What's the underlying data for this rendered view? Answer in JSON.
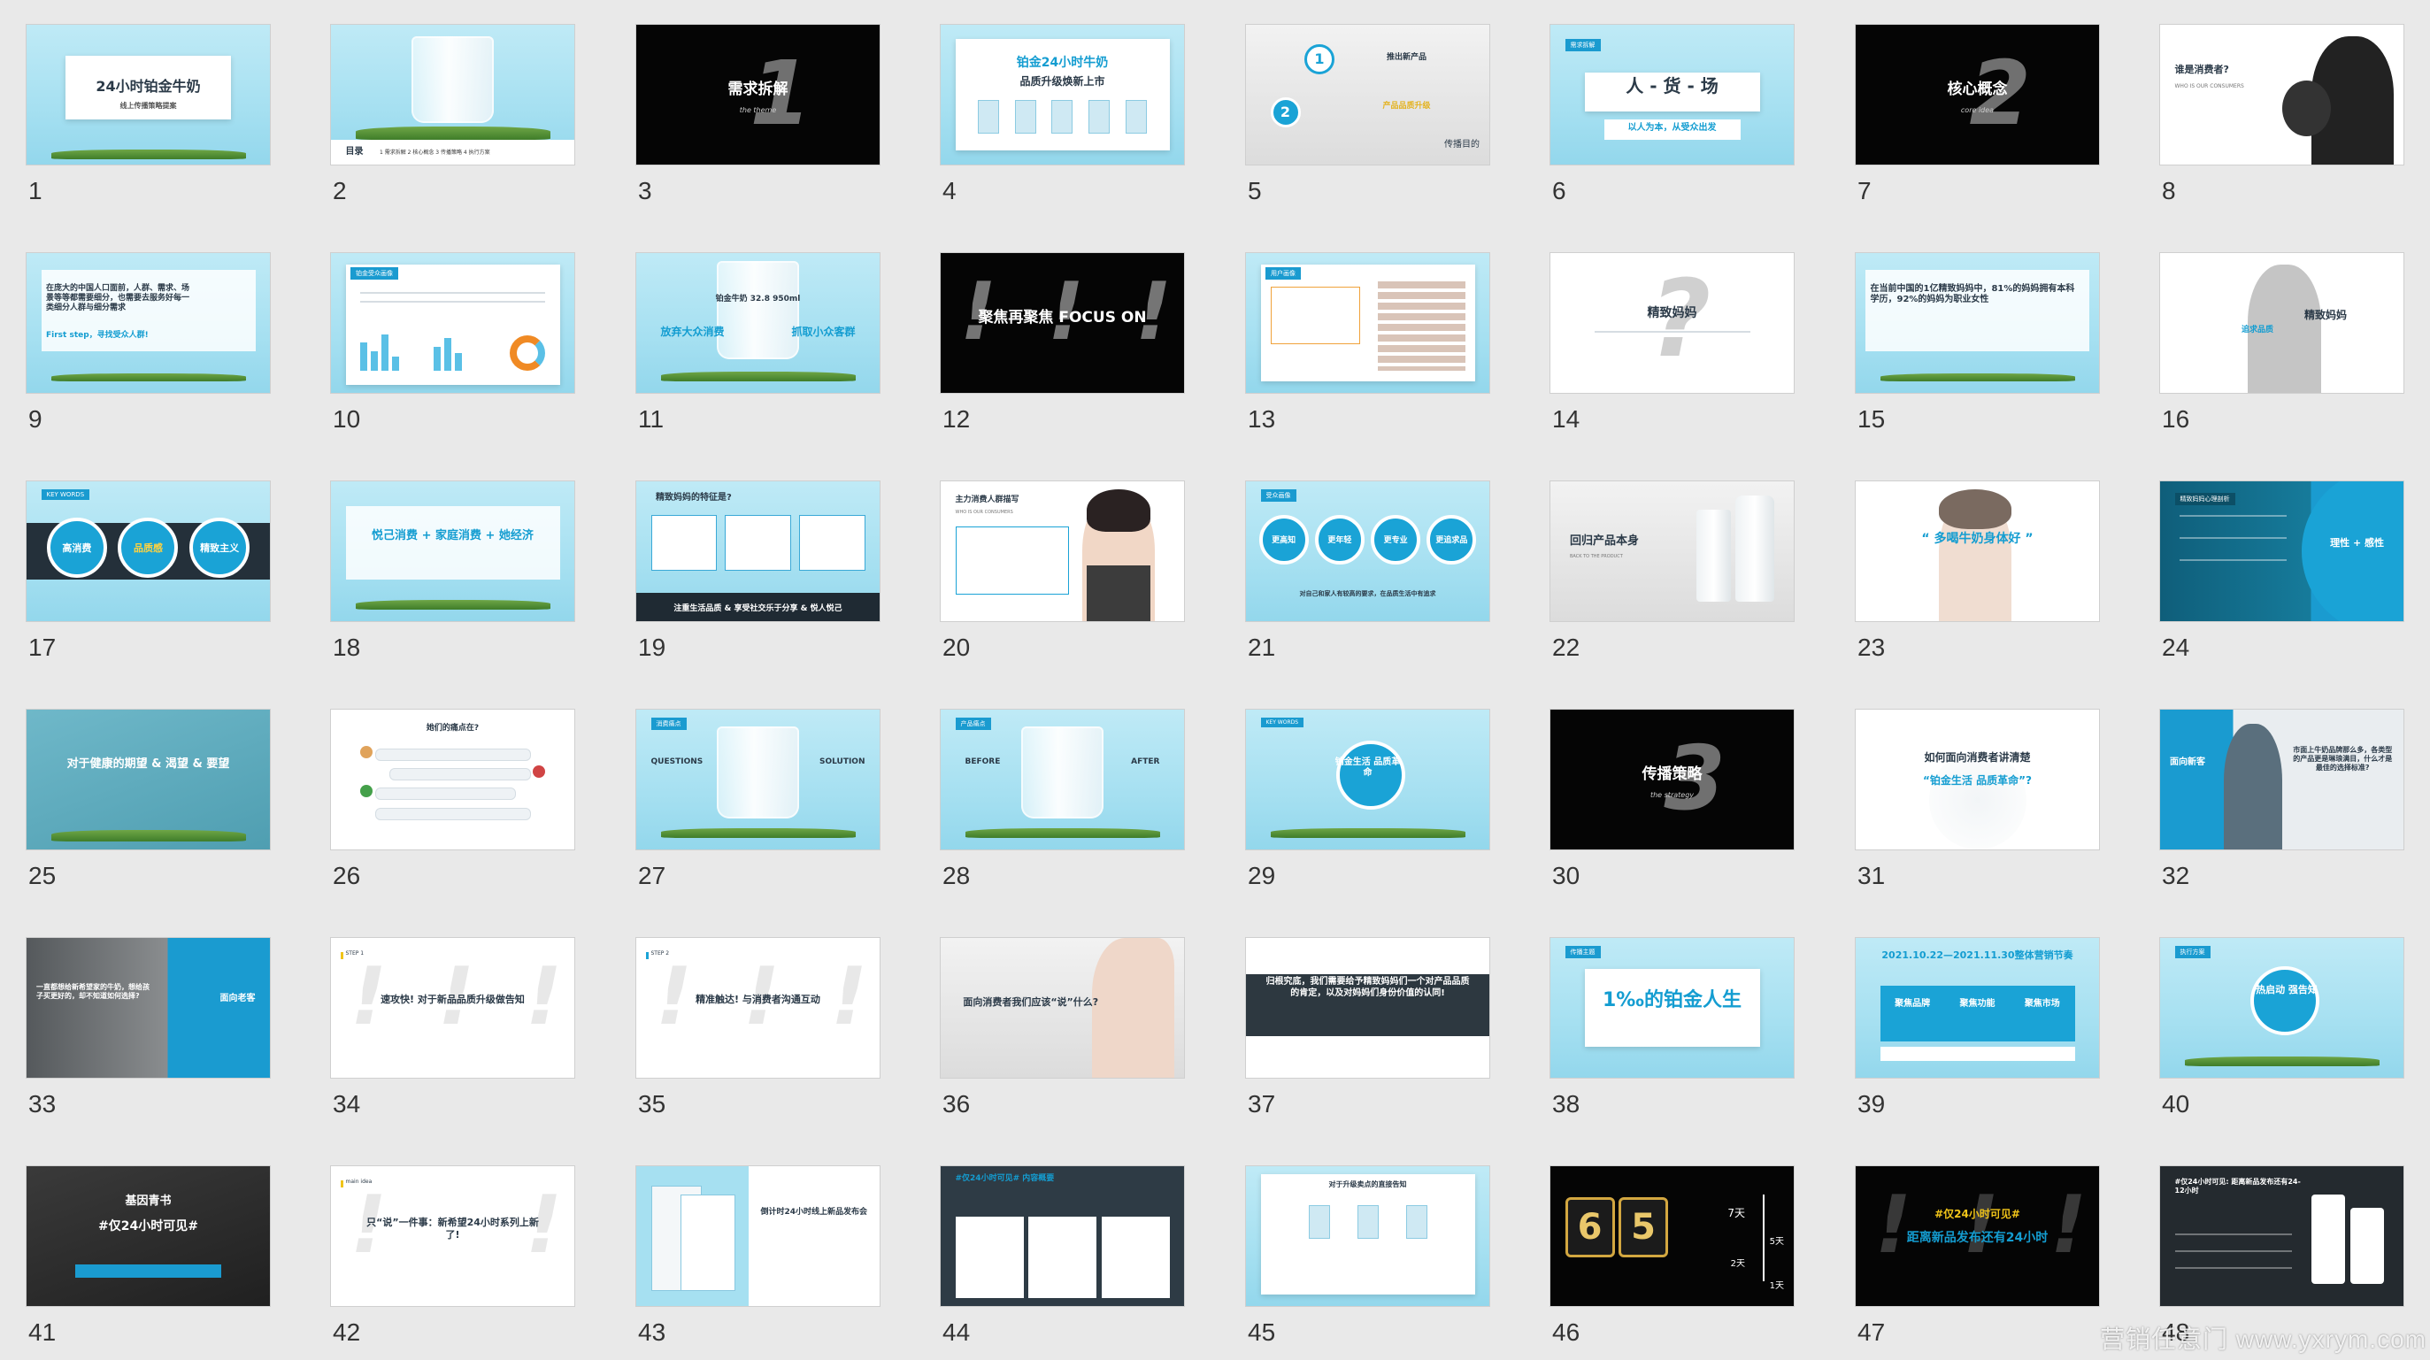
{
  "app": {
    "view": "slide-sorter"
  },
  "slides": [
    {
      "n": "1",
      "title": "24小时铂金牛奶",
      "subtitle": "线上传播策略提案"
    },
    {
      "n": "2",
      "title": "目录",
      "toc": "1 需求拆解 2 核心概念 3 传播策略 4 执行方案"
    },
    {
      "n": "3",
      "title": "需求拆解",
      "subtitle": "the theme",
      "big": "1"
    },
    {
      "n": "4",
      "title": "铂金24小时牛奶",
      "subtitle": "品质升级焕新上市"
    },
    {
      "n": "5",
      "title": "推出新产品",
      "sub2": "产品品质升级",
      "foot": "传播目的"
    },
    {
      "n": "6",
      "title": "人 - 货 - 场",
      "subtitle": "以人为本，从受众出发"
    },
    {
      "n": "7",
      "title": "核心概念",
      "subtitle": "core idea",
      "big": "2"
    },
    {
      "n": "8",
      "title": "谁是消费者?",
      "subtitle": "WHO IS OUR CONSUMERS"
    },
    {
      "n": "9",
      "title": "在庞大的中国人口面前，人群、需求、场景等等都需要细分，也需要去服务好每一类细分人群与细分需求",
      "subtitle": "First step，寻找受众人群!"
    },
    {
      "n": "10",
      "title": "铂金受众画像"
    },
    {
      "n": "11",
      "title": "铂金牛奶 32.8 950ml",
      "left": "放弃大众消费",
      "right": "抓取小众客群"
    },
    {
      "n": "12",
      "title": "聚焦再聚焦 FOCUS ON"
    },
    {
      "n": "13",
      "title": "用户画像"
    },
    {
      "n": "14",
      "title": "精致妈妈",
      "big": "?"
    },
    {
      "n": "15",
      "title": "在当前中国的1亿精致妈妈中，81%的妈妈拥有本科学历，92%的妈妈为职业女性"
    },
    {
      "n": "16",
      "title": "精致妈妈",
      "subtitle": "追求品质"
    },
    {
      "n": "17",
      "tag": "KEY WORDS",
      "c1": "高消费",
      "c2": "品质感",
      "c3": "精致主义"
    },
    {
      "n": "18",
      "title": "悦己消费 + 家庭消费 + 她经济"
    },
    {
      "n": "19",
      "title": "精致妈妈的特征是?",
      "band": "注重生活品质 & 享受社交乐于分享 & 悦人悦己"
    },
    {
      "n": "20",
      "title": "主力消费人群描写",
      "subtitle": "WHO IS OUR CONSUMERS"
    },
    {
      "n": "21",
      "c1": "更高知",
      "c2": "更年轻",
      "c3": "更专业",
      "c4": "更追求品",
      "foot": "对自己和家人有较高的要求，在品质生活中有追求"
    },
    {
      "n": "22",
      "title": "回归产品本身",
      "subtitle": "BACK TO THE PRODUCT"
    },
    {
      "n": "23",
      "title": "“ 多喝牛奶身体好 ”"
    },
    {
      "n": "24",
      "title": "精致妈妈心理剖析",
      "right": "理性 + 感性"
    },
    {
      "n": "25",
      "title": "对于健康的期望 & 渴望 & 要望"
    },
    {
      "n": "26",
      "title": "她们的痛点在?"
    },
    {
      "n": "27",
      "tag": "消费痛点",
      "left": "QUESTIONS",
      "right": "SOLUTION"
    },
    {
      "n": "28",
      "tag": "产品痛点",
      "left": "BEFORE",
      "right": "AFTER"
    },
    {
      "n": "29",
      "tag": "KEY WORDS",
      "title": "铂金生活 品质革命"
    },
    {
      "n": "30",
      "title": "传播策略",
      "subtitle": "the strategy",
      "big": "3"
    },
    {
      "n": "31",
      "title": "如何面向消费者讲清楚",
      "subtitle": "“铂金生活 品质革命”?"
    },
    {
      "n": "32",
      "title": "面向新客",
      "right": "市面上牛奶品牌那么多，各类型的产品更是琳琅满目，什么才是最佳的选择标准?"
    },
    {
      "n": "33",
      "title": "一直都想给新希望家的牛奶，想给孩子买更好的，却不知道如何选择?",
      "right": "面向老客"
    },
    {
      "n": "34",
      "tag": "STEP 1",
      "title": "速攻快! 对于新品品质升级做告知"
    },
    {
      "n": "35",
      "tag": "STEP 2",
      "title": "精准触达! 与消费者沟通互动"
    },
    {
      "n": "36",
      "title": "面向消费者我们应该“说”什么?"
    },
    {
      "n": "37",
      "title": "归根究底，我们需要给予精致妈妈们一个对产品品质的肯定，以及对妈妈们身份价值的认同!"
    },
    {
      "n": "38",
      "tag": "传播主题",
      "title": "1‰的铂金人生"
    },
    {
      "n": "39",
      "title": "2021.10.22—2021.11.30整体营销节奏",
      "c1": "聚焦品牌",
      "c2": "聚焦功能",
      "c3": "聚焦市场"
    },
    {
      "n": "40",
      "title": "热启动 强告知"
    },
    {
      "n": "41",
      "title": "基因青书",
      "subtitle": "#仅24小时可见#"
    },
    {
      "n": "42",
      "tag": "main idea",
      "title": "只“说”一件事：新希望24小时系列上新了!"
    },
    {
      "n": "43",
      "title": "倒计时24小时线上新品发布会"
    },
    {
      "n": "44",
      "title": "#仅24小时可见# 内容概要"
    },
    {
      "n": "45",
      "title": "对于升级卖点的直接告知"
    },
    {
      "n": "46",
      "left": "6",
      "right": "5",
      "t1": "7天",
      "t2": "5天",
      "t3": "2天",
      "t4": "1天"
    },
    {
      "n": "47",
      "title": "#仅24小时可见#",
      "subtitle": "距离新品发布还有24小时"
    },
    {
      "n": "48",
      "title": "#仅24小时可见: 距离新品发布还有24-12小时"
    }
  ],
  "watermark": "营销任意门 www.yxrym.com",
  "colors": {
    "accent": "#149dd1",
    "sky": "#a6e0f1",
    "dark": "#24303a",
    "bg": "#e9e9e9"
  }
}
